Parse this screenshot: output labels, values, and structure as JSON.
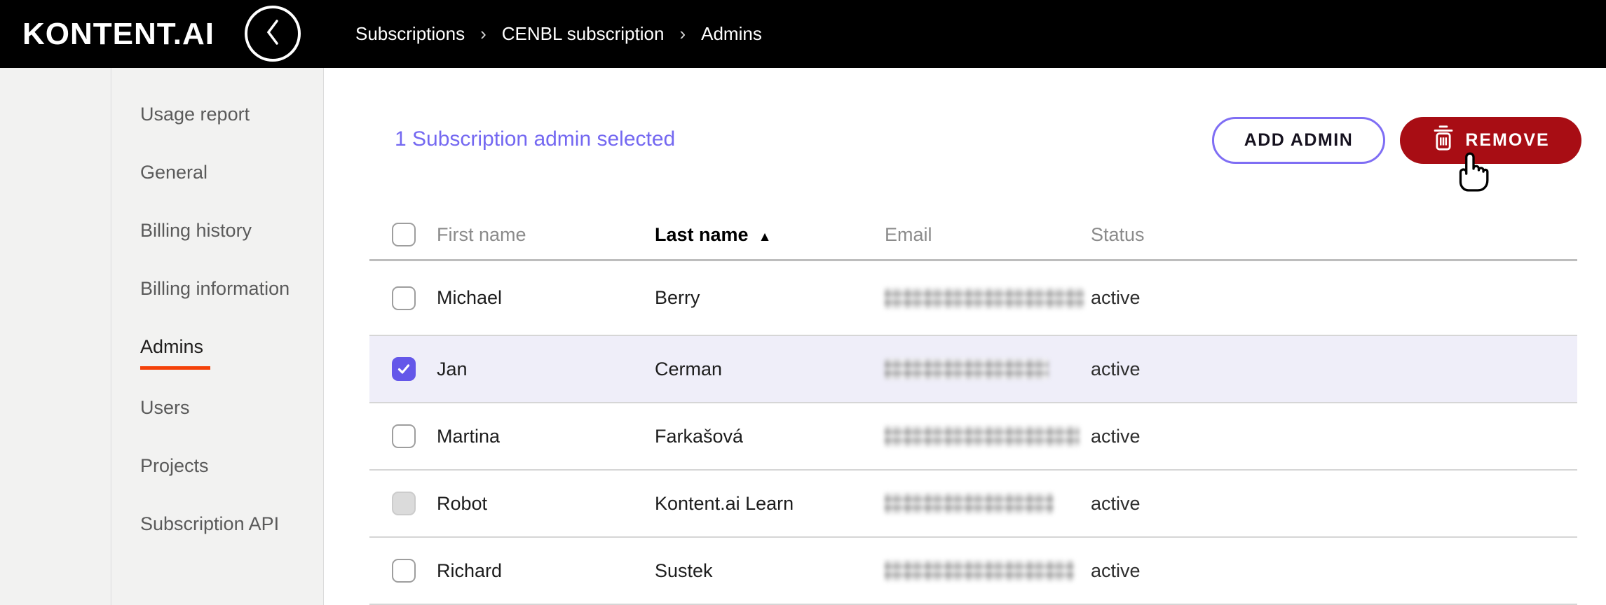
{
  "colors": {
    "topbar_bg": "#000000",
    "accent_purple": "#7468f1",
    "checkbox_purple": "#6457e9",
    "add_button_border": "#7f6ef4",
    "remove_button_bg": "#a80d14",
    "active_tab_underline": "#f4420a",
    "selected_row_bg": "#efeef9",
    "sidebar_bg": "#f2f2f1"
  },
  "header": {
    "logo_text": "KONTENT.AI",
    "back_icon": "chevron-left",
    "breadcrumb": [
      "Subscriptions",
      "CENBL subscription",
      "Admins"
    ],
    "breadcrumb_separator": "›"
  },
  "sidebar": {
    "items": [
      {
        "label": "Usage report",
        "active": false
      },
      {
        "label": "General",
        "active": false
      },
      {
        "label": "Billing history",
        "active": false
      },
      {
        "label": "Billing information",
        "active": false
      },
      {
        "label": "Admins",
        "active": true
      },
      {
        "label": "Users",
        "active": false
      },
      {
        "label": "Projects",
        "active": false
      },
      {
        "label": "Subscription API",
        "active": false
      }
    ]
  },
  "toolbar": {
    "selection_text": "1 Subscription admin selected",
    "add_admin_label": "ADD ADMIN",
    "remove_label": "REMOVE",
    "remove_icon": "trash-icon"
  },
  "table": {
    "columns": [
      "First name",
      "Last name",
      "Email",
      "Status"
    ],
    "sort_column": "Last name",
    "sort_direction": "ascending",
    "sort_arrow": "▲",
    "header_checkbox_checked": false,
    "rows": [
      {
        "first_name": "Michael",
        "last_name": "Berry",
        "email_redacted": true,
        "email_blur_width": 285,
        "status": "active",
        "checked": false,
        "disabled": false,
        "selected": false
      },
      {
        "first_name": "Jan",
        "last_name": "Cerman",
        "email_redacted": true,
        "email_blur_width": 234,
        "status": "active",
        "checked": true,
        "disabled": false,
        "selected": true
      },
      {
        "first_name": "Martina",
        "last_name": "Farkašová",
        "email_redacted": true,
        "email_blur_width": 278,
        "status": "active",
        "checked": false,
        "disabled": false,
        "selected": false
      },
      {
        "first_name": "Robot",
        "last_name": "Kontent.ai Learn",
        "email_redacted": true,
        "email_blur_width": 241,
        "status": "active",
        "checked": false,
        "disabled": true,
        "selected": false
      },
      {
        "first_name": "Richard",
        "last_name": "Sustek",
        "email_redacted": true,
        "email_blur_width": 270,
        "status": "active",
        "checked": false,
        "disabled": false,
        "selected": false
      }
    ]
  }
}
